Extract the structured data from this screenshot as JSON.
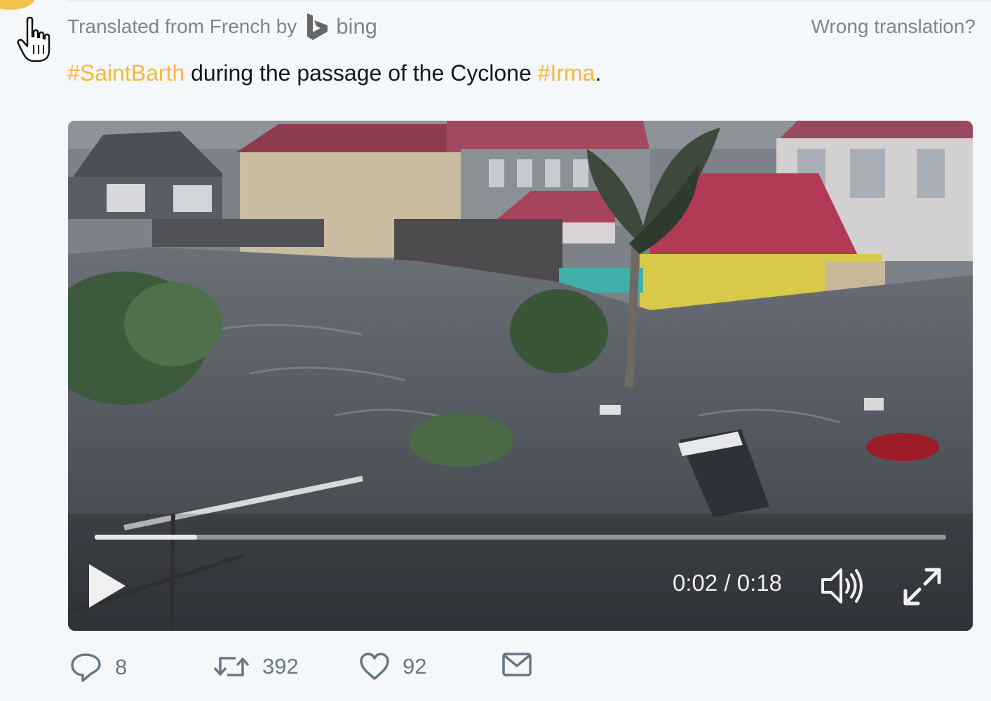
{
  "translation": {
    "label": "Translated from French by",
    "provider": "bing",
    "wrong_link": "Wrong translation?"
  },
  "tweet": {
    "hashtag1": "#SaintBarth",
    "text_middle": " during the passage of the Cyclone ",
    "hashtag2": "#Irma",
    "text_end": "."
  },
  "video": {
    "time": "0:02 / 0:18",
    "progress": 0.12
  },
  "actions": {
    "replies": "8",
    "retweets": "392",
    "likes": "92"
  },
  "colors": {
    "hashtag": "#f6b93b",
    "muted_text": "#7b8590",
    "icon_gray": "#657786"
  }
}
